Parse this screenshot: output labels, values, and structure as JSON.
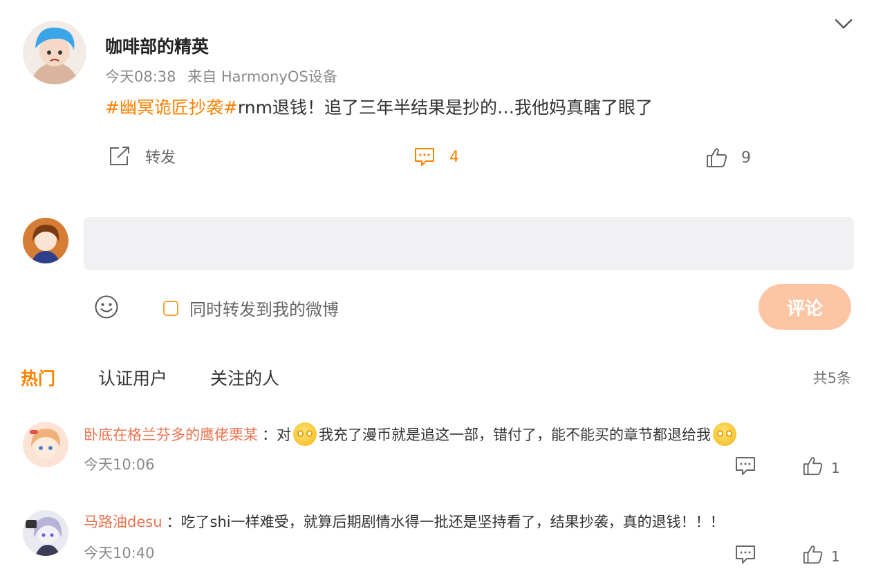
{
  "post": {
    "author": "咖啡部的精英",
    "time": "今天08:38",
    "source": "来自 HarmonyOS设备",
    "topic": "#幽冥诡匠抄袭#",
    "text": "rnm退钱！追了三年半结果是抄的…我他妈真瞎了眼了",
    "repost_label": "转发",
    "comment_count": "4",
    "like_count": "9",
    "icons": {
      "menu": "chevron-down-icon",
      "repost": "share-icon",
      "comment": "comment-icon",
      "like": "thumbs-up-icon"
    }
  },
  "composer": {
    "placeholder": "",
    "emoji_icon": "smiley-icon",
    "also_repost_label": "同时转发到我的微博",
    "submit_label": "评论"
  },
  "tabs": {
    "items": [
      "热门",
      "认证用户",
      "关注的人"
    ],
    "active": "热门",
    "total": "共5条"
  },
  "comments": [
    {
      "user": "卧底在格兰芬多的鹰佬栗某",
      "sep": "：对",
      "text_mid": "我充了漫币就是追这一部，错付了，能不能买的章节都退给我",
      "time": "今天10:06",
      "like_count": "1"
    },
    {
      "user": "马路油desu",
      "sep": "：",
      "text_mid": "吃了shi一样难受，就算后期剧情水得一批还是坚持看了，结果抄袭，真的退钱！！！",
      "time": "今天10:40",
      "like_count": "1"
    }
  ],
  "colors": {
    "accent": "#ff8200",
    "username": "#eb7350",
    "submit_bg": "#fcc6a4"
  }
}
